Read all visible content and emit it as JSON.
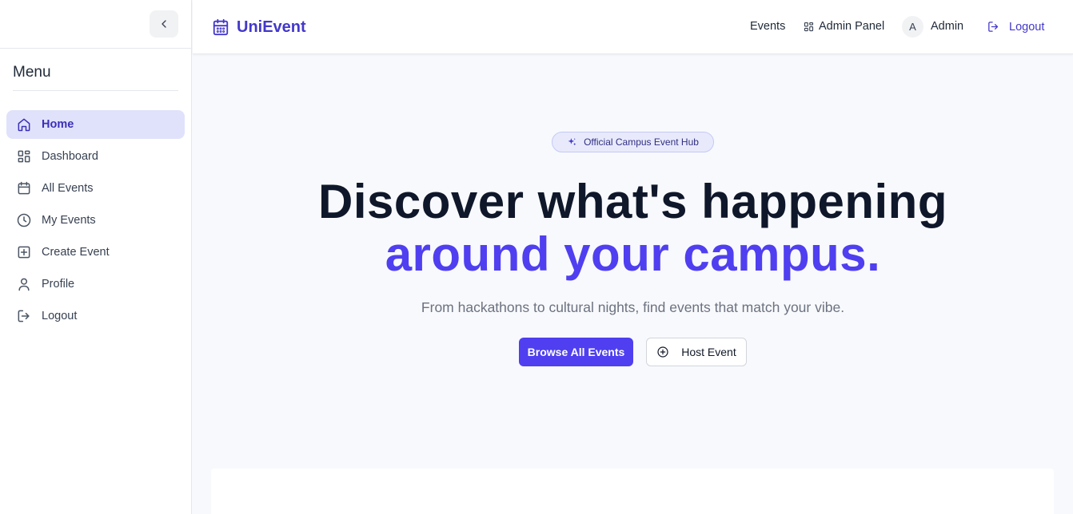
{
  "sidebar": {
    "menu_title": "Menu",
    "items": [
      {
        "label": "Home",
        "icon": "home-icon",
        "active": true
      },
      {
        "label": "Dashboard",
        "icon": "grid-icon"
      },
      {
        "label": "All Events",
        "icon": "calendar-icon"
      },
      {
        "label": "My Events",
        "icon": "clock-icon"
      },
      {
        "label": "Create Event",
        "icon": "plus-square-icon"
      },
      {
        "label": "Profile",
        "icon": "user-icon"
      },
      {
        "label": "Logout",
        "icon": "logout-icon"
      }
    ]
  },
  "header": {
    "brand": "UniEvent",
    "nav": {
      "events": "Events",
      "admin_panel": "Admin Panel",
      "avatar_initial": "A",
      "user_name": "Admin",
      "logout": "Logout"
    }
  },
  "hero": {
    "badge": "Official Campus Event Hub",
    "title_line1": "Discover what's happening",
    "title_line2": "around your campus.",
    "subtitle": "From hackathons to cultural nights, find events that match your vibe.",
    "primary_button": "Browse All Events",
    "secondary_button": "Host Event"
  },
  "colors": {
    "accent": "#4f3ff0",
    "brand": "#4338ca",
    "active_nav_bg": "#e0e2fb",
    "page_bg": "#f8f9fc"
  }
}
